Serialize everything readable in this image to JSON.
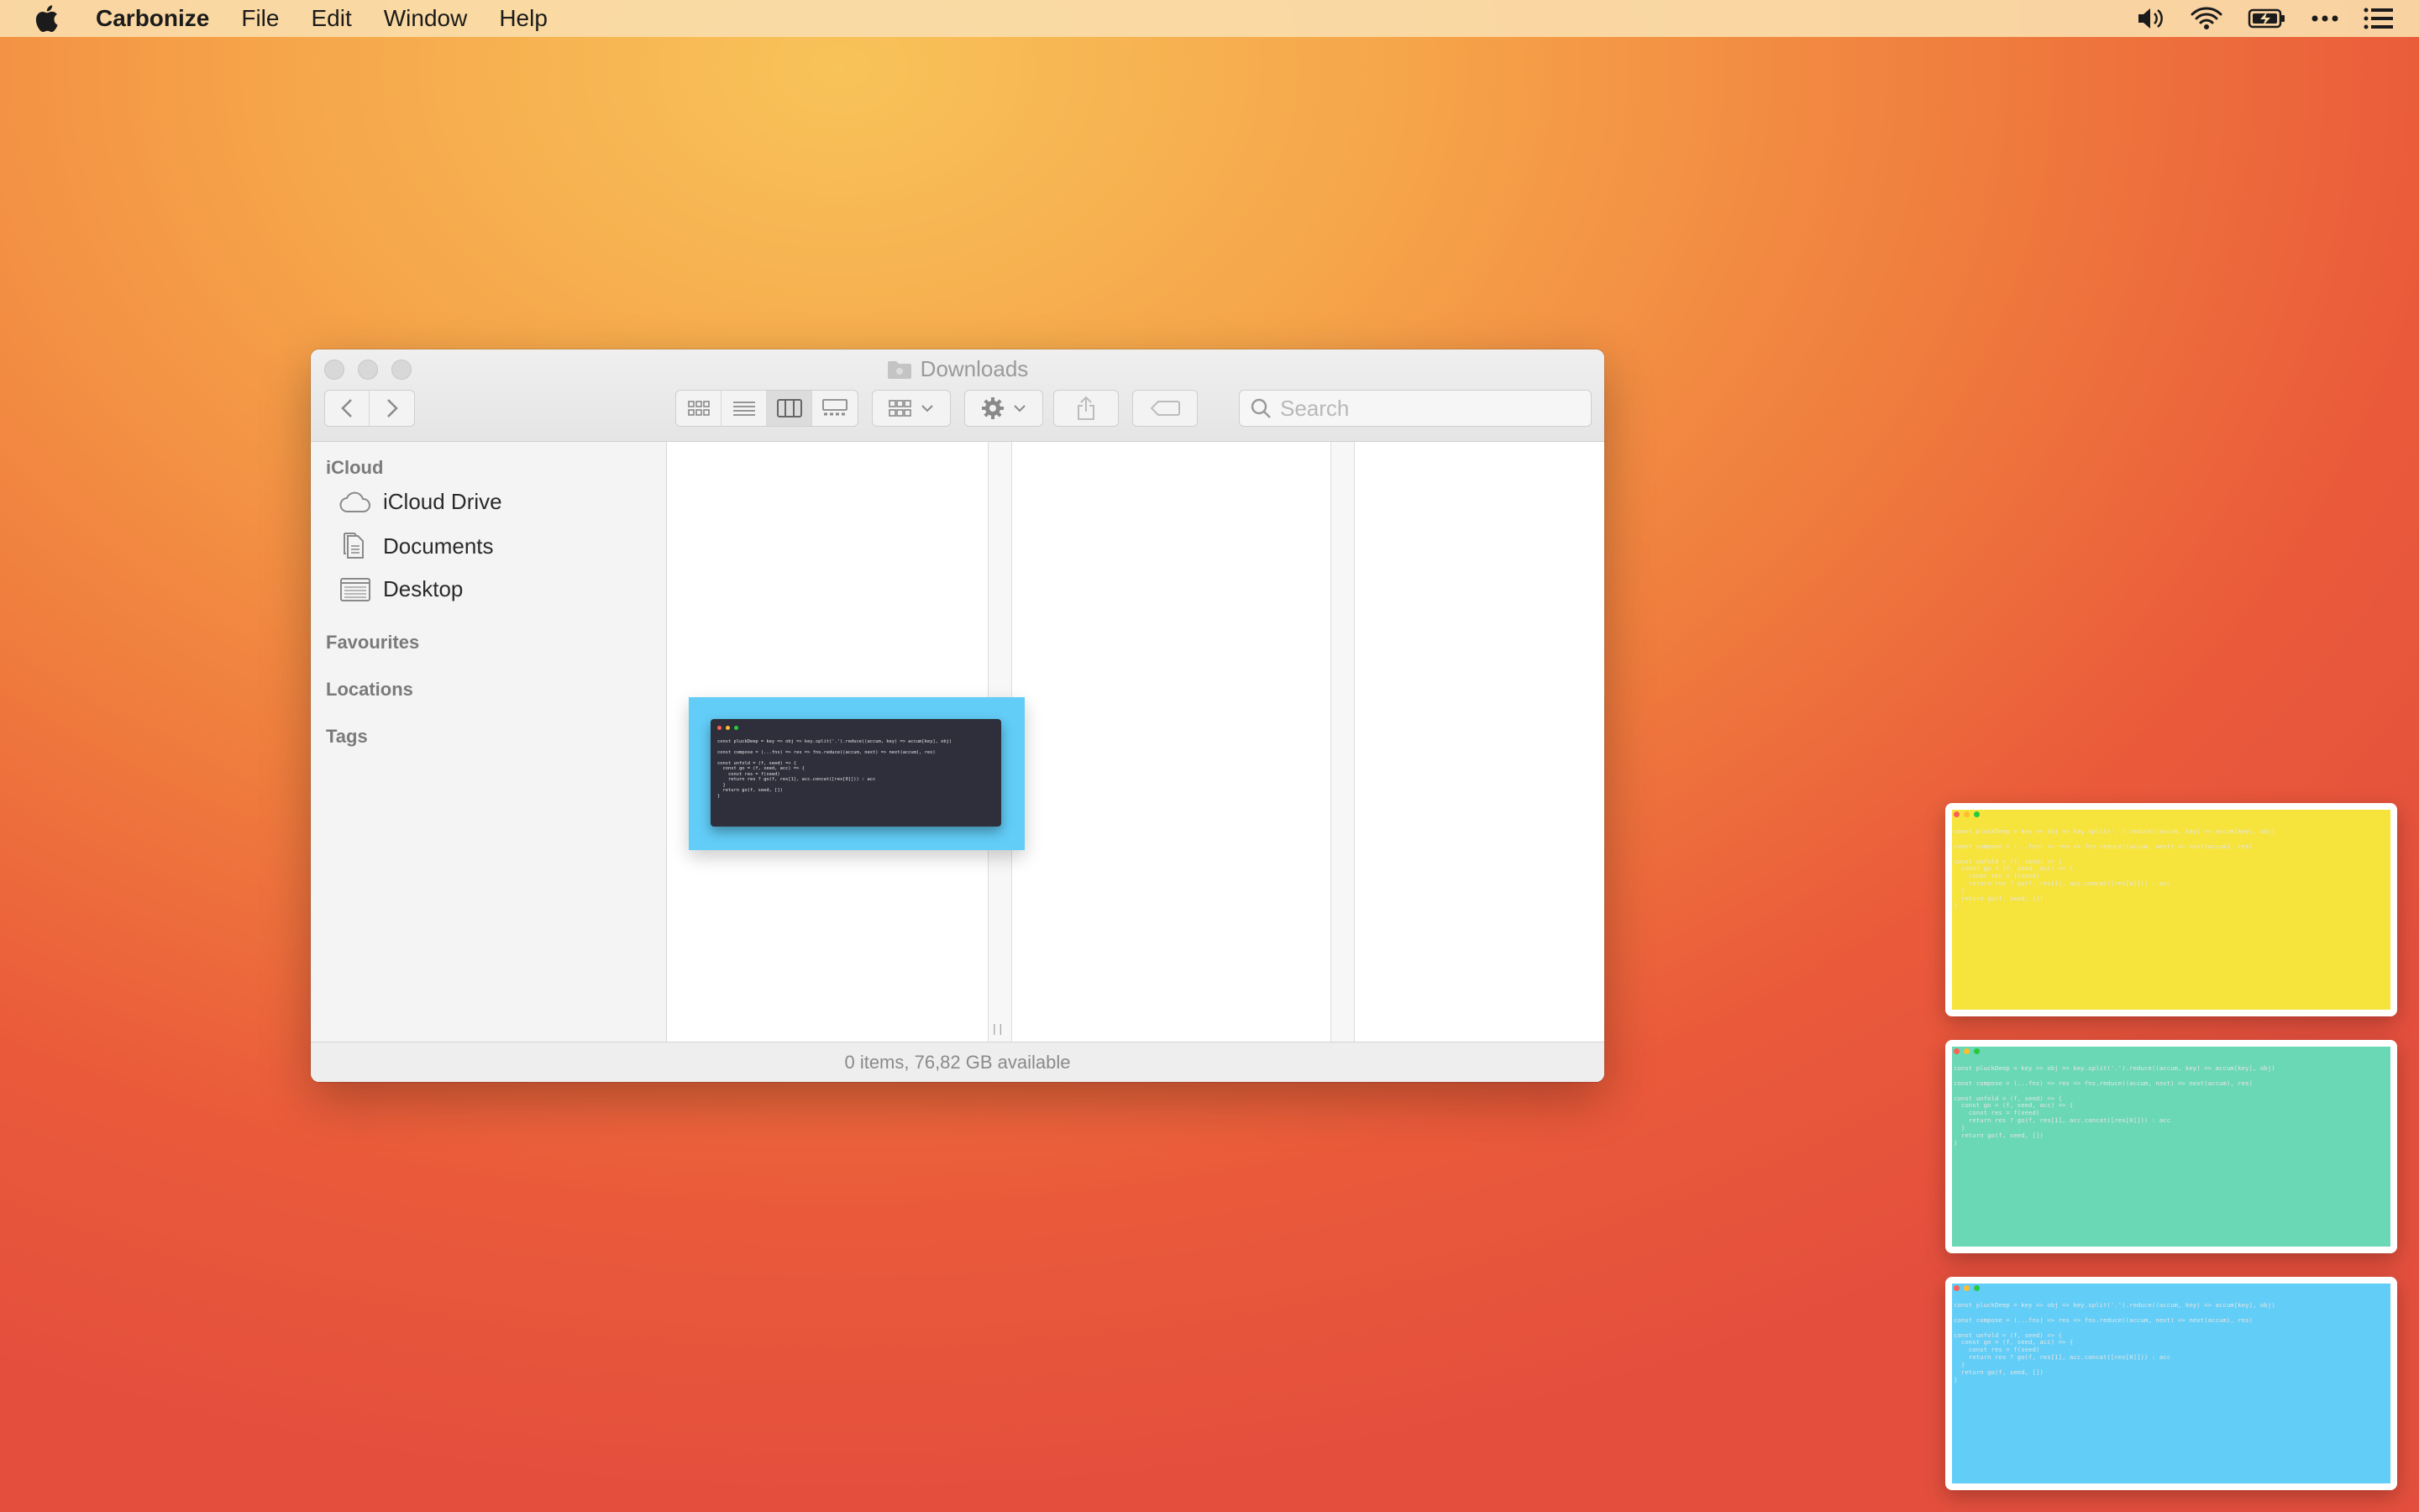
{
  "menubar": {
    "app_name": "Carbonize",
    "items": [
      "File",
      "Edit",
      "Window",
      "Help"
    ]
  },
  "window": {
    "title": "Downloads",
    "search_placeholder": "Search",
    "status": "0 items, 76,82 GB available",
    "sidebar": {
      "icloud_header": "iCloud",
      "items": [
        "iCloud Drive",
        "Documents",
        "Desktop"
      ],
      "favourites": "Favourites",
      "locations": "Locations",
      "tags": "Tags"
    }
  },
  "code": {
    "lines": [
      "const pluckDeep = key => obj => key.split('.').reduce((accum, key) => accum[key], obj)",
      "",
      "const compose = (...fns) => res => fns.reduce((accum, next) => next(accum), res)",
      "",
      "const unfold = (f, seed) => {",
      "  const go = (f, seed, acc) => {",
      "    const res = f(seed)",
      "    return res ? go(f, res[1], acc.concat([res[0]])) : acc",
      "  }",
      "  return go(f, seed, [])",
      "}"
    ]
  },
  "colors": {
    "blue_bg": "#62cdf7",
    "yellow_bg": "#f6e33c",
    "green_bg": "#6ad8b4",
    "dot_red": "#ff5f56",
    "dot_yellow": "#ffbd2e",
    "dot_green": "#27c93f"
  }
}
